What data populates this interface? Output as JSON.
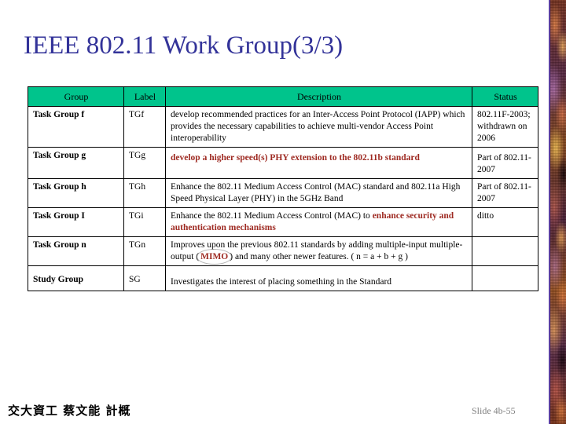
{
  "slide": {
    "title": "IEEE 802.11 Work Group(3/3)",
    "title_color": "#333399",
    "background": "#ffffff"
  },
  "table": {
    "header_bg": "#00C48C",
    "highlight_color": "#9E2A22",
    "columns": [
      "Group",
      "Label",
      "Description",
      "Status"
    ],
    "rows": [
      {
        "group": "Task Group f",
        "label": "TGf",
        "description": "develop recommended practices for an Inter-Access Point Protocol (IAPP) which provides the necessary capabilities to achieve multi-vendor Access Point interoperability",
        "status": "802.11F-2003; withdrawn on 2006"
      },
      {
        "group": "Task Group g",
        "label": "TGg",
        "description_highlight": "develop a higher speed(s) PHY extension to the 802.11b standard",
        "status": "Part of 802.11-2007"
      },
      {
        "group": "Task Group h",
        "label": "TGh",
        "description": "Enhance the 802.11 Medium Access Control (MAC) standard and 802.11a High Speed Physical Layer (PHY) in the 5GHz Band",
        "status": "Part of 802.11-2007"
      },
      {
        "group": "Task Group I",
        "label": "TGi",
        "description_plain": "Enhance the 802.11 Medium Access Control (MAC) to",
        "description_highlight": "enhance security and authentication mechanisms",
        "status": "ditto"
      },
      {
        "group": "Task Group n",
        "label": "TGn",
        "description_part1": "Improves upon the previous 802.11 standards by adding multiple-input multiple-output (",
        "description_circled": "MIMO",
        "description_part2": ") and many other newer features.  ( n = a + b + g )",
        "status": ""
      },
      {
        "group": "Study Group",
        "label": "SG",
        "description": "Investigates the interest of placing something in the Standard",
        "status": ""
      }
    ]
  },
  "footer": {
    "left": "交大資工 蔡文能 計概",
    "slide_number": "Slide 4b-55"
  }
}
